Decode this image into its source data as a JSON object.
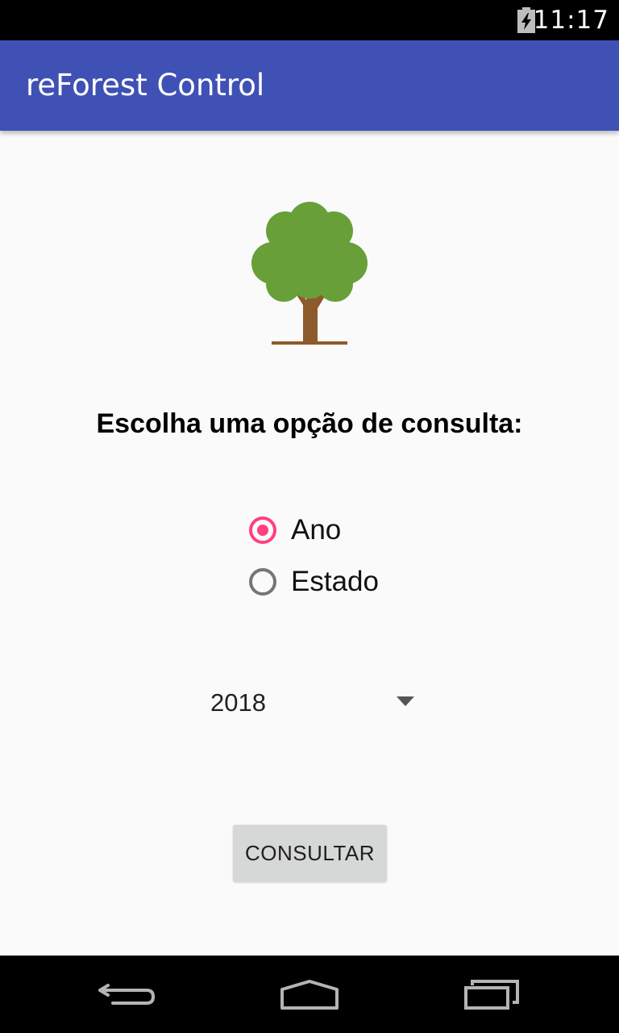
{
  "status_bar": {
    "time": "11:17",
    "battery_icon": "battery-charging-icon"
  },
  "app_bar": {
    "title": "reForest Control"
  },
  "main": {
    "image_icon": "tree-icon",
    "prompt": "Escolha uma opção de consulta:",
    "radio_options": [
      {
        "label": "Ano",
        "checked": true
      },
      {
        "label": "Estado",
        "checked": false
      }
    ],
    "spinner": {
      "selected_value": "2018",
      "icon": "dropdown-arrow-icon"
    },
    "consult_button_label": "CONSULTAR"
  },
  "nav_bar": {
    "buttons": [
      "back-icon",
      "home-icon",
      "recents-icon"
    ]
  },
  "colors": {
    "primary": "#3f51b5",
    "accent": "#ff4081",
    "background": "#fafafa",
    "button": "#d6d7d7",
    "tree_foliage": "#689f38",
    "tree_trunk": "#8d5a2b"
  }
}
